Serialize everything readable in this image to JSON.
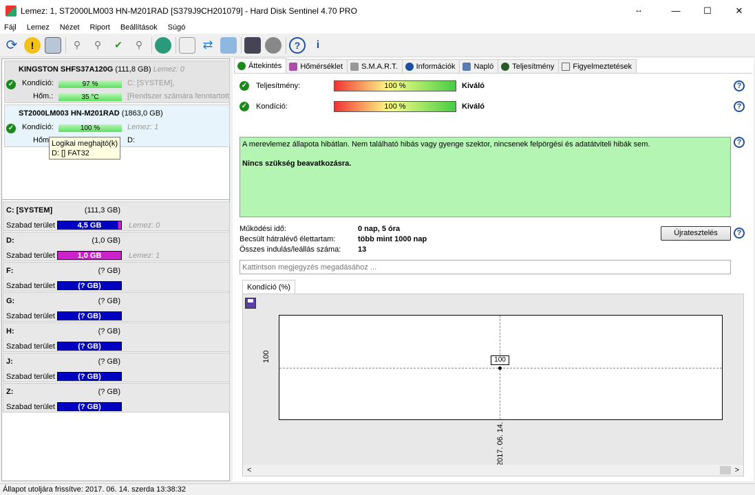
{
  "window": {
    "title": "Lemez: 1, ST2000LM003 HN-M201RAD [S379J9CH201079]  -  Hard Disk Sentinel 4.70 PRO",
    "resize_glyph": "↔",
    "minimize": "—",
    "maximize": "☐",
    "close": "✕"
  },
  "menu": [
    "Fájl",
    "Lemez",
    "Nézet",
    "Riport",
    "Beállítások",
    "Súgó"
  ],
  "disks": [
    {
      "name": "KINGSTON SHFS37A120G",
      "size": "(111,8 GB)",
      "lemez": "Lemez: 0",
      "kondicio_label": "Kondíció:",
      "kondicio": "97 %",
      "hom_label": "Hőm.:",
      "hom": "35 °C",
      "vol": "C: [SYSTEM],",
      "note": "[Rendszer számára fenntartott"
    },
    {
      "name": "ST2000LM003 HN-M201RAD",
      "size": "(1863,0 GB)",
      "lemez": "Lemez: 1",
      "kondicio_label": "Kondíció:",
      "kondicio": "100 %",
      "hom_label": "Hőm",
      "vol": "D:"
    }
  ],
  "tooltip": {
    "line1": "Logikai meghajtó(k)",
    "line2": "D: [] FAT32"
  },
  "volumes": [
    {
      "letter": "C: [SYSTEM]",
      "size": "(111,3 GB)",
      "free_label": "Szabad terület",
      "free": "4,5 GB",
      "lemez": "Lemez: 0",
      "color": "#0000c0"
    },
    {
      "letter": "D:",
      "size": "(1,0 GB)",
      "free_label": "Szabad terület",
      "free": "1,0 GB",
      "lemez": "Lemez: 1",
      "color": "#cc22cc"
    },
    {
      "letter": "F:",
      "size": "(? GB)",
      "free_label": "Szabad terület",
      "free": "(? GB)",
      "lemez": "",
      "color": "#0000c0"
    },
    {
      "letter": "G:",
      "size": "(? GB)",
      "free_label": "Szabad terület",
      "free": "(? GB)",
      "lemez": "",
      "color": "#0000c0"
    },
    {
      "letter": "H:",
      "size": "(? GB)",
      "free_label": "Szabad terület",
      "free": "(? GB)",
      "lemez": "",
      "color": "#0000c0"
    },
    {
      "letter": "J:",
      "size": "(? GB)",
      "free_label": "Szabad terület",
      "free": "(? GB)",
      "lemez": "",
      "color": "#0000c0"
    },
    {
      "letter": "Z:",
      "size": "(? GB)",
      "free_label": "Szabad terület",
      "free": "(? GB)",
      "lemez": "",
      "color": "#0000c0"
    }
  ],
  "tabs": [
    "Áttekintés",
    "Hőmérséklet",
    "S.M.A.R.T.",
    "Információk",
    "Napló",
    "Teljesítmény",
    "Figyelmeztetések"
  ],
  "overview": {
    "teljesitmeny_label": "Teljesítmény:",
    "teljesitmeny": "100 %",
    "teljesitmeny_rating": "Kiváló",
    "kondicio_label": "Kondíció:",
    "kondicio": "100 %",
    "kondicio_rating": "Kiváló",
    "message": "A merevlemez állapota hibátlan. Nem található hibás vagy gyenge szektor, nincsenek felpörgési és adatátviteli hibák sem.",
    "message_bold": "Nincs szükség beavatkozásra.",
    "uptime_label": "Működési idő:",
    "uptime": "0 nap, 5 óra",
    "remaining_label": "Becsült hátralévő élettartam:",
    "remaining": "több mint 1000 nap",
    "starts_label": "Összes indulás/leállás száma:",
    "starts": "13",
    "retest": "Újratesztelés",
    "note_placeholder": "Kattintson megjegyzés megadásához ..."
  },
  "chart_tab": "Kondíció  (%)",
  "chart_data": {
    "type": "line",
    "x": [
      "2017. 06. 14."
    ],
    "series": [
      {
        "values": [
          100
        ]
      }
    ],
    "ytick": "100",
    "data_label": "100"
  },
  "statusbar": "Állapot utoljára frissítve: 2017. 06. 14. szerda 13:38:32",
  "colors": {
    "ok": "#1a8a1a",
    "green_box": "#b4f5b4",
    "volume_bar": "#0000c0",
    "volume_bar_d": "#cc22cc"
  }
}
